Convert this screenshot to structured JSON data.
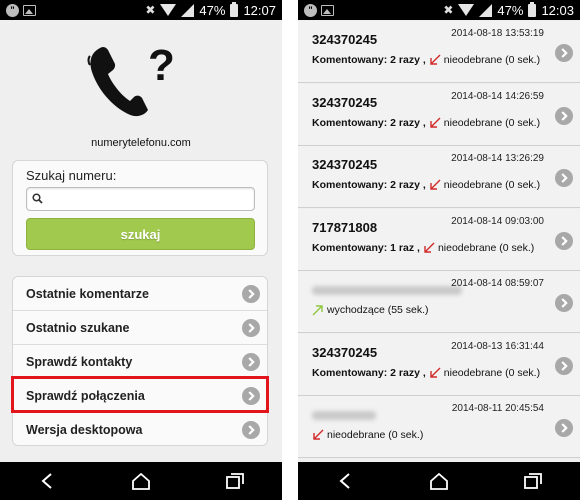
{
  "left_screen": {
    "status": {
      "battery_pct": "47%",
      "time": "12:07"
    },
    "site_name": "numerytelefonu.com",
    "search": {
      "label": "Szukaj numeru:",
      "value": "",
      "button_label": "szukaj"
    },
    "menu": [
      {
        "label": "Ostatnie komentarze"
      },
      {
        "label": "Ostatnio szukane"
      },
      {
        "label": "Sprawdź kontakty"
      },
      {
        "label": "Sprawdź połączenia",
        "highlighted": true
      },
      {
        "label": "Wersja desktopowa"
      }
    ],
    "highlight_color": "#e2151d",
    "accent_color": "#a1c94e"
  },
  "right_screen": {
    "status": {
      "battery_pct": "47%",
      "time": "12:03"
    },
    "calls": [
      {
        "number": "324370245",
        "blurred": false,
        "date": "2014-08-18 13:53:19",
        "comment": "Komentowany: 2 razy ,",
        "call_type": "missed",
        "status": "nieodebrane (0 sek.)"
      },
      {
        "number": "324370245",
        "blurred": false,
        "date": "2014-08-14 14:26:59",
        "comment": "Komentowany: 2 razy ,",
        "call_type": "missed",
        "status": "nieodebrane (0 sek.)"
      },
      {
        "number": "324370245",
        "blurred": false,
        "date": "2014-08-14 13:26:29",
        "comment": "Komentowany: 2 razy ,",
        "call_type": "missed",
        "status": "nieodebrane (0 sek.)"
      },
      {
        "number": "717871808",
        "blurred": false,
        "date": "2014-08-14 09:03:00",
        "comment": "Komentowany: 1 raz ,",
        "call_type": "missed",
        "status": "nieodebrane (0 sek.)"
      },
      {
        "number": "",
        "blurred": true,
        "date": "2014-08-14 08:59:07",
        "comment": "",
        "call_type": "outgoing",
        "status": "wychodzące (55 sek.)"
      },
      {
        "number": "324370245",
        "blurred": false,
        "date": "2014-08-13 16:31:44",
        "comment": "Komentowany: 2 razy ,",
        "call_type": "missed",
        "status": "nieodebrane (0 sek.)"
      },
      {
        "number": "",
        "blurred": true,
        "date": "2014-08-11 20:45:54",
        "comment": "",
        "call_type": "missed",
        "status": "nieodebrane (0 sek.)"
      }
    ],
    "missed_color": "#d12a2a",
    "outgoing_color": "#8ec63f"
  }
}
